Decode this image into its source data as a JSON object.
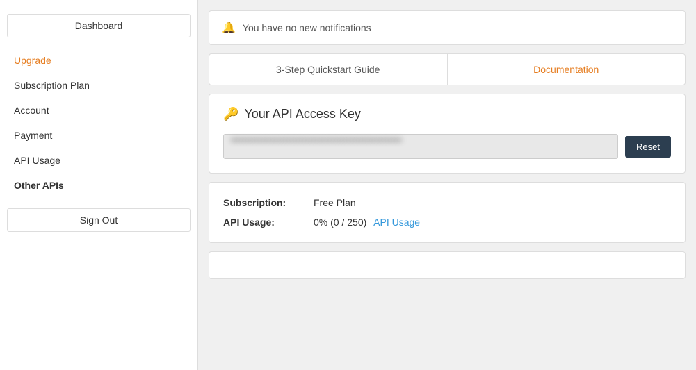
{
  "sidebar": {
    "dashboard_label": "Dashboard",
    "upgrade_label": "Upgrade",
    "subscription_plan_label": "Subscription Plan",
    "account_label": "Account",
    "payment_label": "Payment",
    "api_usage_label": "API Usage",
    "other_apis_label": "Other APIs",
    "sign_out_label": "Sign Out"
  },
  "notification": {
    "bell": "🔔",
    "text": "You have no new notifications"
  },
  "tabs": {
    "quickstart_label": "3-Step Quickstart Guide",
    "documentation_label": "Documentation"
  },
  "api_key": {
    "title": "Your API Access Key",
    "key_icon": "🔑",
    "key_value": "••••••••••••••••••••••••••••••••••••••••••••••••••••••",
    "reset_label": "Reset"
  },
  "subscription": {
    "subscription_label": "Subscription:",
    "subscription_value": "Free Plan",
    "api_usage_label": "API Usage:",
    "api_usage_value": "0% (0 / 250)",
    "api_usage_link": "API Usage"
  }
}
